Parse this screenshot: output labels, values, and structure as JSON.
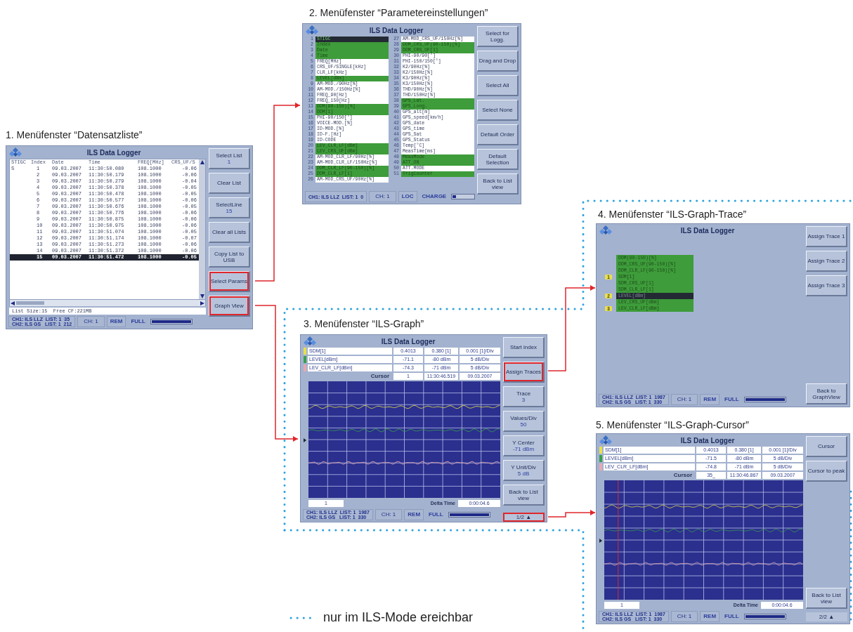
{
  "screens": [
    {
      "kind": "list",
      "caption": "1. Menüfenster “Datensatzliste”",
      "title": "ILS Data Logger",
      "columns": [
        "STIGC",
        "Index",
        "Date",
        "Time",
        "FREQ[MHz]",
        "CRS_UF/S"
      ],
      "rows": [
        {
          "stigc": "S",
          "index": "1",
          "date": "09.03.2007",
          "time": "11:30:50.080",
          "freq": "108.1000",
          "crs": "-0.06",
          "selected": false
        },
        {
          "index": "2",
          "date": "09.03.2007",
          "time": "11:30:50.179",
          "freq": "108.1000",
          "crs": "-0.06",
          "selected": false
        },
        {
          "index": "3",
          "date": "09.03.2007",
          "time": "11:30:50.279",
          "freq": "108.1000",
          "crs": "-0.04",
          "selected": false
        },
        {
          "index": "4",
          "date": "09.03.2007",
          "time": "11:30:50.378",
          "freq": "108.1000",
          "crs": "-0.05",
          "selected": false
        },
        {
          "index": "5",
          "date": "09.03.2007",
          "time": "11:30:50.478",
          "freq": "108.1000",
          "crs": "-0.05",
          "selected": false
        },
        {
          "index": "6",
          "date": "09.03.2007",
          "time": "11:30:50.577",
          "freq": "108.1000",
          "crs": "-0.06",
          "selected": false
        },
        {
          "index": "7",
          "date": "09.03.2007",
          "time": "11:30:50.676",
          "freq": "108.1000",
          "crs": "-0.05",
          "selected": false
        },
        {
          "index": "8",
          "date": "09.03.2007",
          "time": "11:30:50.776",
          "freq": "108.1000",
          "crs": "-0.06",
          "selected": false
        },
        {
          "index": "9",
          "date": "09.03.2007",
          "time": "11:30:50.875",
          "freq": "108.1000",
          "crs": "-0.06",
          "selected": false
        },
        {
          "index": "10",
          "date": "09.03.2007",
          "time": "11:30:50.975",
          "freq": "108.1000",
          "crs": "-0.06",
          "selected": false
        },
        {
          "index": "11",
          "date": "09.03.2007",
          "time": "11:30:51.074",
          "freq": "108.1000",
          "crs": "-0.05",
          "selected": false
        },
        {
          "index": "12",
          "date": "09.03.2007",
          "time": "11:30:51.174",
          "freq": "108.1000",
          "crs": "-0.07",
          "selected": false
        },
        {
          "index": "13",
          "date": "09.03.2007",
          "time": "11:30:51.273",
          "freq": "108.1000",
          "crs": "-0.06",
          "selected": false
        },
        {
          "index": "14",
          "date": "09.03.2007",
          "time": "11:30:51.372",
          "freq": "108.1000",
          "crs": "-0.06",
          "selected": false
        },
        {
          "index": "15",
          "date": "09.03.2007",
          "time": "11:30:51.472",
          "freq": "108.1000",
          "crs": "-0.05",
          "selected": true
        }
      ],
      "footer": "List Size:15  Free CF:221MB",
      "status": {
        "info": [
          "CH1: ILS LLZ  LIST: 1  35",
          "CH2: ILS GS   LIST: 1  212"
        ],
        "channel": "CH: 1",
        "mode": "REM",
        "power": "FULL",
        "level": 1
      },
      "buttons": [
        {
          "kind": "button",
          "label": "Select List",
          "value": "1",
          "highlighted": false
        },
        {
          "kind": "button",
          "label": "Clear List",
          "highlighted": false
        },
        {
          "kind": "button",
          "label": "SelectLine",
          "value": "15",
          "highlighted": false
        },
        {
          "kind": "button",
          "label": "Clear all Lists",
          "highlighted": false
        },
        {
          "kind": "button",
          "label": "Copy List to USB",
          "highlighted": false
        },
        {
          "kind": "button",
          "label": "Select Params",
          "highlighted": true
        },
        {
          "kind": "button",
          "label": "Graph View",
          "highlighted": true
        }
      ]
    },
    {
      "kind": "params",
      "caption": "2. Menüfenster “Parametereinstellungen”",
      "title": "ILS Data Logger",
      "params": [
        {
          "number": "1",
          "label": "STIGC",
          "highlighted": true,
          "selected": true
        },
        {
          "number": "2",
          "label": "Index",
          "highlighted": true,
          "selected": false
        },
        {
          "number": "3",
          "label": "Date",
          "highlighted": true,
          "selected": false
        },
        {
          "number": "4",
          "label": "Time",
          "highlighted": true,
          "selected": false
        },
        {
          "number": "5",
          "label": "FREQ[MHz]",
          "highlighted": false,
          "selected": false
        },
        {
          "number": "6",
          "label": "CRS_UF/SINGLE[kHz]",
          "highlighted": false,
          "selected": false
        },
        {
          "number": "7",
          "label": "CLR_LF[kHz]",
          "highlighted": false,
          "selected": false
        },
        {
          "number": "8",
          "label": "LEVEL[dBm]",
          "highlighted": true,
          "selected": false
        },
        {
          "number": "9",
          "label": "AM-MOD./90Hz[%]",
          "highlighted": false,
          "selected": false
        },
        {
          "number": "10",
          "label": "AM-MOD./150Hz[%]",
          "highlighted": false,
          "selected": false
        },
        {
          "number": "11",
          "label": "FREQ_90[Hz]",
          "highlighted": false,
          "selected": false
        },
        {
          "number": "12",
          "label": "FREQ_150[Hz]",
          "highlighted": false,
          "selected": false
        },
        {
          "number": "13",
          "label": "DDM(90-150)[%]",
          "highlighted": true,
          "selected": false
        },
        {
          "number": "14",
          "label": "DDM[1]",
          "highlighted": true,
          "selected": false
        },
        {
          "number": "15",
          "label": "PHI-90/150[°]",
          "highlighted": false,
          "selected": false
        },
        {
          "number": "16",
          "label": "VOICE-MOD.[%]",
          "highlighted": false,
          "selected": false
        },
        {
          "number": "17",
          "label": "ID-MOD.[%]",
          "highlighted": false,
          "selected": false
        },
        {
          "number": "18",
          "label": "ID-F.[Hz]",
          "highlighted": false,
          "selected": false
        },
        {
          "number": "19",
          "label": "ID-CODE",
          "highlighted": false,
          "selected": false
        },
        {
          "number": "20",
          "label": "LEV_CLR_LF[dBm]",
          "highlighted": true,
          "selected": false
        },
        {
          "number": "21",
          "label": "LEV_CRS_UF[dBm]",
          "highlighted": true,
          "selected": false
        },
        {
          "number": "22",
          "label": "AM-MOD_CLR_LF/90Hz[%]",
          "highlighted": false,
          "selected": false
        },
        {
          "number": "23",
          "label": "AM-MOD_CLR_LF/150Hz[%]",
          "highlighted": false,
          "selected": false
        },
        {
          "number": "24",
          "label": "DDM_CLR_LF(90-150)[%]",
          "highlighted": true,
          "selected": false
        },
        {
          "number": "25",
          "label": "DDM_CLR_LF[1]",
          "highlighted": true,
          "selected": false
        },
        {
          "number": "26",
          "label": "AM-MOD_CRS_UF/90Hz[%]",
          "highlighted": false,
          "selected": false
        },
        {
          "number": "27",
          "label": "AM-MOD_CRS_UF/150Hz[%]",
          "highlighted": false,
          "selected": false
        },
        {
          "number": "28",
          "label": "DDM_CRS_UF(90-150)[%]",
          "highlighted": true,
          "selected": false
        },
        {
          "number": "29",
          "label": "DDM_CRS_UF[1]",
          "highlighted": true,
          "selected": false
        },
        {
          "number": "30",
          "label": "PHI-90/90[°]",
          "highlighted": false,
          "selected": false
        },
        {
          "number": "31",
          "label": "PHI-150/150[°]",
          "highlighted": false,
          "selected": false
        },
        {
          "number": "32",
          "label": "K2/90Hz[%]",
          "highlighted": false,
          "selected": false
        },
        {
          "number": "33",
          "label": "K2/150Hz[%]",
          "highlighted": false,
          "selected": false
        },
        {
          "number": "34",
          "label": "K3/90Hz[%]",
          "highlighted": false,
          "selected": false
        },
        {
          "number": "35",
          "label": "K3/150Hz[%]",
          "highlighted": false,
          "selected": false
        },
        {
          "number": "36",
          "label": "THD/90Hz[%]",
          "highlighted": false,
          "selected": false
        },
        {
          "number": "37",
          "label": "THD/150Hz[%]",
          "highlighted": false,
          "selected": false
        },
        {
          "number": "38",
          "label": "GPS_Lat.",
          "highlighted": true,
          "selected": false
        },
        {
          "number": "39",
          "label": "GPS_Long.",
          "highlighted": true,
          "selected": false
        },
        {
          "number": "40",
          "label": "GPS_alt[m]",
          "highlighted": false,
          "selected": false
        },
        {
          "number": "41",
          "label": "GPS_speed[km/h]",
          "highlighted": false,
          "selected": false
        },
        {
          "number": "42",
          "label": "GPS_date",
          "highlighted": false,
          "selected": false
        },
        {
          "number": "43",
          "label": "GPS_time",
          "highlighted": false,
          "selected": false
        },
        {
          "number": "44",
          "label": "GPS_Sat",
          "highlighted": false,
          "selected": false
        },
        {
          "number": "45",
          "label": "GPS_Status",
          "highlighted": false,
          "selected": false
        },
        {
          "number": "46",
          "label": "Temp[°C]",
          "highlighted": false,
          "selected": false
        },
        {
          "number": "47",
          "label": "MeasTime[ms]",
          "highlighted": false,
          "selected": false
        },
        {
          "number": "48",
          "label": "MeasMode",
          "highlighted": true,
          "selected": false
        },
        {
          "number": "49",
          "label": "ATT_ON",
          "highlighted": true,
          "selected": false
        },
        {
          "number": "50",
          "label": "ATT.MODE",
          "highlighted": false,
          "selected": false
        },
        {
          "number": "51",
          "label": "TrigCounter",
          "highlighted": true,
          "selected": false
        }
      ],
      "status": {
        "info": [
          "CH1: ILS LLZ  LIST: 1  0"
        ],
        "channel": "CH: 1",
        "mode": "LOC",
        "power": "CHARGE",
        "level": 0.15
      },
      "buttons": [
        {
          "kind": "button",
          "label": "Select for Logg.",
          "highlighted": false
        },
        {
          "kind": "button",
          "label": "Drag and Drop",
          "highlighted": false
        },
        {
          "kind": "button",
          "label": "Select All",
          "highlighted": false
        },
        {
          "kind": "button",
          "label": "Select None",
          "highlighted": false
        },
        {
          "kind": "button",
          "label": "Default Order",
          "highlighted": false
        },
        {
          "kind": "button",
          "label": "Default Selection",
          "highlighted": false
        },
        {
          "kind": "button",
          "label": "Back to List view",
          "highlighted": false
        }
      ]
    },
    {
      "kind": "graph",
      "caption": "3. Menüfenster “ILS-Graph”",
      "title": "ILS Data Logger",
      "cursor_line": false,
      "traces": [
        {
          "name": "SDM[1]",
          "color": "#e8e04a",
          "value": "0.4013",
          "reference": "0.380 [1]",
          "scale": "0.001 [1]/Div"
        },
        {
          "name": "LEVEL[dBm]",
          "color": "#3aa04a",
          "value": "-71.1",
          "reference": "-80 dBm",
          "scale": "5 dB/Div"
        },
        {
          "name": "LEV_CLR_LF[dBm]",
          "color": "#e8a8b0",
          "value": "-74.3",
          "reference": "-71 dBm",
          "scale": "5 dB/Div"
        }
      ],
      "cursor": {
        "label": "Cursor",
        "index": "1",
        "time": "11:30:46.519",
        "date": "09.03.2007"
      },
      "plot_footer": {
        "start": "1",
        "delta_label": "Delta Time",
        "delta": "0:00:04.6"
      },
      "status": {
        "info": [
          "CH1: ILS LLZ  LIST: 1  1987",
          "CH2: ILS GS   LIST: 1  330"
        ],
        "channel": "CH: 1",
        "mode": "REM",
        "power": "FULL",
        "level": 1
      },
      "buttons": [
        {
          "kind": "button",
          "label": "Start index",
          "highlighted": false
        },
        {
          "kind": "button",
          "label": "Assign Traces",
          "highlighted": true
        },
        {
          "kind": "button",
          "label": "Trace",
          "value": "3",
          "highlighted": false
        },
        {
          "kind": "button",
          "label": "Values/Div",
          "value": "50",
          "highlighted": false
        },
        {
          "kind": "button",
          "label": "Y Center",
          "value": "-71 dBm",
          "highlighted": false
        },
        {
          "kind": "button",
          "label": "Y Unit/Div",
          "value": "5 dB",
          "highlighted": false
        },
        {
          "kind": "button",
          "label": "Back to List view",
          "highlighted": false
        },
        {
          "kind": "spacer"
        },
        {
          "kind": "page",
          "label": "1/2 ▲",
          "highlighted": true
        }
      ]
    },
    {
      "kind": "trace",
      "caption": "4. Menüfenster “ILS-Graph-Trace”",
      "title": "ILS Data Logger",
      "items": [
        {
          "label": "DDM(90-150)[%]",
          "selected": false
        },
        {
          "label": "DDM_CRS_UF(90-150)[%]",
          "selected": false
        },
        {
          "label": "DDM_CLR_LF(90-150)[%]",
          "selected": false
        },
        {
          "label": "SDM[1]",
          "marker": "1",
          "selected": false
        },
        {
          "label": "SDM_CRS_UF[1]",
          "selected": false
        },
        {
          "label": "SDM_CLR_LF[1]",
          "selected": false
        },
        {
          "label": "LEVEL[dBm]",
          "marker": "2",
          "selected": true
        },
        {
          "label": "LEV_CRS_UF[dBm]",
          "selected": false
        },
        {
          "label": "LEV_CLR_LF[dBm]",
          "marker": "3",
          "selected": false
        }
      ],
      "status": {
        "info": [
          "CH1: ILS LLZ  LIST: 1  1987",
          "CH2: ILS GS   LIST: 1  330"
        ],
        "channel": "CH: 1",
        "mode": "REM",
        "power": "FULL",
        "level": 1
      },
      "buttons": [
        {
          "kind": "button",
          "label": "Assign Trace 1",
          "highlighted": false
        },
        {
          "kind": "button",
          "label": "Assign Trace 2",
          "highlighted": false
        },
        {
          "kind": "button",
          "label": "Assign Trace 3",
          "highlighted": false
        },
        {
          "kind": "spacer"
        },
        {
          "kind": "button",
          "label": "Back to GraphView",
          "highlighted": false
        }
      ]
    },
    {
      "kind": "graph",
      "caption": "5. Menüfenster “ILS-Graph-Cursor”",
      "title": "ILS Data Logger",
      "cursor_line": true,
      "traces": [
        {
          "name": "SDM[1]",
          "color": "#e8e04a",
          "value": "0.4013",
          "reference": "0.380 [1]",
          "scale": "0.001 [1]/Div"
        },
        {
          "name": "LEVEL[dBm]",
          "color": "#3aa04a",
          "value": "-71.5",
          "reference": "-80 dBm",
          "scale": "5 dB/Div"
        },
        {
          "name": "LEV_CLR_LF[dBm]",
          "color": "#e8a8b0",
          "value": "-74.8",
          "reference": "-71 dBm",
          "scale": "5 dB/Div"
        }
      ],
      "cursor": {
        "label": "Cursor",
        "index": "35_",
        "time": "11:30:46.867",
        "date": "09.03.2007"
      },
      "plot_footer": {
        "start": "1",
        "delta_label": "Delta Time",
        "delta": "0:00:04.6"
      },
      "status": {
        "info": [
          "CH1: ILS LLZ  LIST: 1  1987",
          "CH2: ILS GS   LIST: 1  330"
        ],
        "channel": "CH: 1",
        "mode": "REM",
        "power": "FULL",
        "level": 1
      },
      "buttons": [
        {
          "kind": "button",
          "label": "Cursor",
          "highlighted": false
        },
        {
          "kind": "button",
          "label": "Cursor to peak",
          "highlighted": false
        },
        {
          "kind": "spacer"
        },
        {
          "kind": "button",
          "label": "Back to List view",
          "highlighted": false
        },
        {
          "kind": "page",
          "label": "2/2 ▲",
          "highlighted": false
        }
      ]
    }
  ],
  "legend": {
    "text": "nur im ILS-Mode ereichbar"
  }
}
